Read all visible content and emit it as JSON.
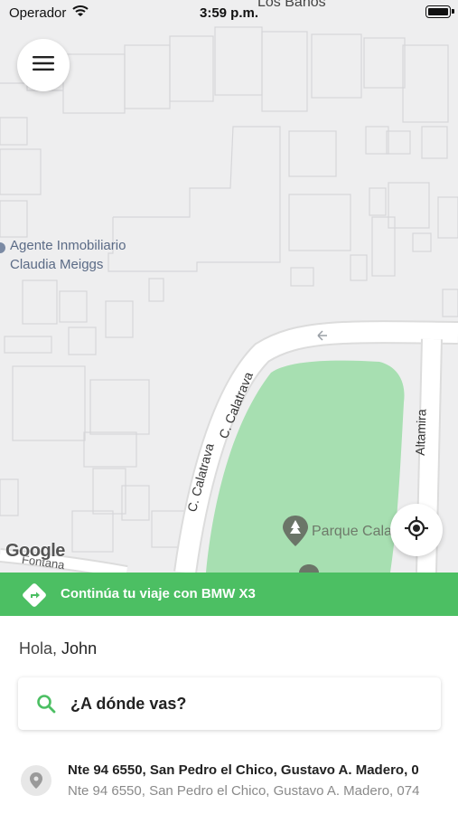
{
  "status_bar": {
    "carrier": "Operador",
    "time": "3:59 p.m."
  },
  "map": {
    "top_label": "Los Baños",
    "poi_name_line1": "Agente Inmobiliario",
    "poi_name_line2": "Claudia Meiggs",
    "park_name": "Parque Cala",
    "streets": {
      "calatrava_a": "C. Calatrava",
      "calatrava_b": "C. Calatrava",
      "altamira": "Altamira",
      "bottom_left": "Fontana"
    },
    "attribution": "Google",
    "park_color": "#a7dfb1"
  },
  "trip_banner": {
    "text": "Continúa tu viaje con BMW X3",
    "color": "#4cbf63"
  },
  "sheet": {
    "greeting_prefix": "Hola,",
    "greeting_name": "John",
    "search_placeholder": "¿A dónde vas?",
    "recent": [
      {
        "title": "Nte 94 6550, San Pedro el Chico, Gustavo A. Madero, 0",
        "subtitle": "Nte 94 6550, San Pedro el Chico, Gustavo A. Madero, 074"
      }
    ]
  },
  "icons": {
    "menu": "hamburger-menu-icon",
    "locate": "my-location-icon",
    "trip": "directions-icon",
    "search": "search-icon",
    "pin": "location-pin-icon"
  }
}
